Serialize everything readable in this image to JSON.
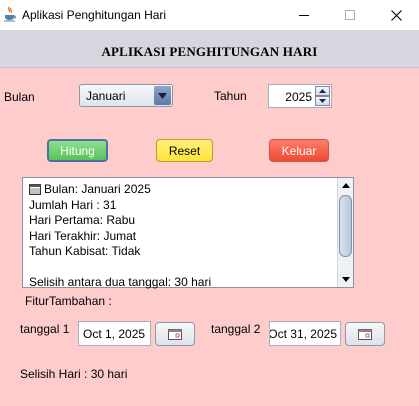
{
  "window": {
    "title": "Aplikasi Penghitungan Hari",
    "app_icon": "java-cup-icon",
    "controls": [
      "minimize-icon",
      "maximize-icon",
      "close-icon"
    ]
  },
  "header": {
    "title": "APLIKASI PENGHITUNGAN HARI"
  },
  "form": {
    "bulan_label": "Bulan",
    "bulan_value": "Januari",
    "tahun_label": "Tahun",
    "tahun_value": "2025"
  },
  "buttons": {
    "hitung": "Hitung",
    "reset": "Reset",
    "keluar": "Keluar"
  },
  "colors": {
    "background": "#ffcccc",
    "hitung": "#66cc66",
    "reset": "#ffee44",
    "keluar": "#f55a45"
  },
  "output": {
    "lines": [
      "Bulan: Januari 2025",
      "Jumlah Hari : 31",
      "Hari Pertama: Rabu",
      "Hari Terakhir: Jumat",
      "Tahun Kabisat: Tidak",
      "",
      "Selisih antara dua tanggal: 30 hari"
    ]
  },
  "fitur": {
    "label": "FiturTambahan :",
    "tanggal1_label": "tanggal 1",
    "tanggal1_value": "Oct 1, 2025",
    "tanggal2_label": "tanggal 2",
    "tanggal2_value": "Oct 31, 2025",
    "selisih": "Selisih Hari : 30 hari"
  }
}
